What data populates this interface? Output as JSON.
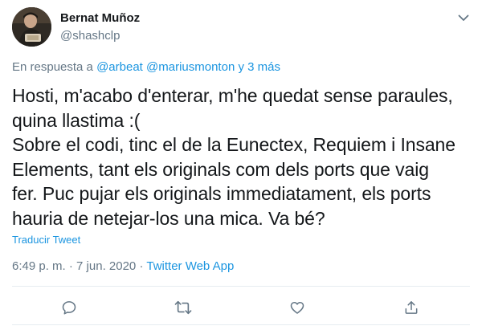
{
  "author": {
    "name": "Bernat Muñoz",
    "handle": "@shashclp"
  },
  "reply_context": {
    "prefix": "En respuesta a",
    "mention_1": "@arbeat",
    "mention_2": "@mariusmonton",
    "suffix": "y 3 más"
  },
  "tweet": {
    "lines": [
      "Hosti, m'acabo d'enterar, m'he quedat sense paraules,",
      "quina llastima :(",
      "Sobre el codi, tinc el de la Eunectex, Requiem i Insane",
      "Elements, tant els originals com dels ports que vaig",
      "fer. Puc pujar els originals immediatament, els ports",
      "hauria de netejar-los una mica. Va bé?"
    ],
    "translate_label": "Traducir Tweet"
  },
  "meta": {
    "time": "6:49 p. m.",
    "separator": "·",
    "date": "7 jun. 2020",
    "source": "Twitter Web App"
  },
  "icons": {
    "caret": "chevron-down-icon",
    "reply": "reply-icon",
    "retweet": "retweet-icon",
    "like": "heart-icon",
    "share": "share-icon"
  },
  "colors": {
    "link": "#1b95e0",
    "secondary_text": "#657786",
    "primary_text": "#14171a",
    "divider": "#e6ecf0"
  }
}
